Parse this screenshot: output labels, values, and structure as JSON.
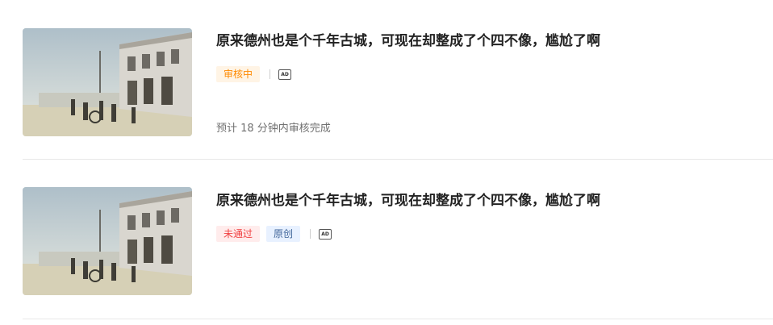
{
  "articles": [
    {
      "title": "原来德州也是个千年古城，可现在却整成了个四不像，尴尬了啊",
      "tags": [
        {
          "label": "审核中",
          "kind": "pending"
        }
      ],
      "ad_icon_text": "AD",
      "eta": "预计 18 分钟内审核完成"
    },
    {
      "title": "原来德州也是个千年古城，可现在却整成了个四不像，尴尬了啊",
      "tags": [
        {
          "label": "未通过",
          "kind": "rejected"
        },
        {
          "label": "原创",
          "kind": "original"
        }
      ],
      "ad_icon_text": "AD"
    }
  ],
  "colors": {
    "pending": "#ff8a00",
    "rejected": "#f04142",
    "original": "#406599",
    "title": "#222222",
    "meta": "#707070"
  }
}
